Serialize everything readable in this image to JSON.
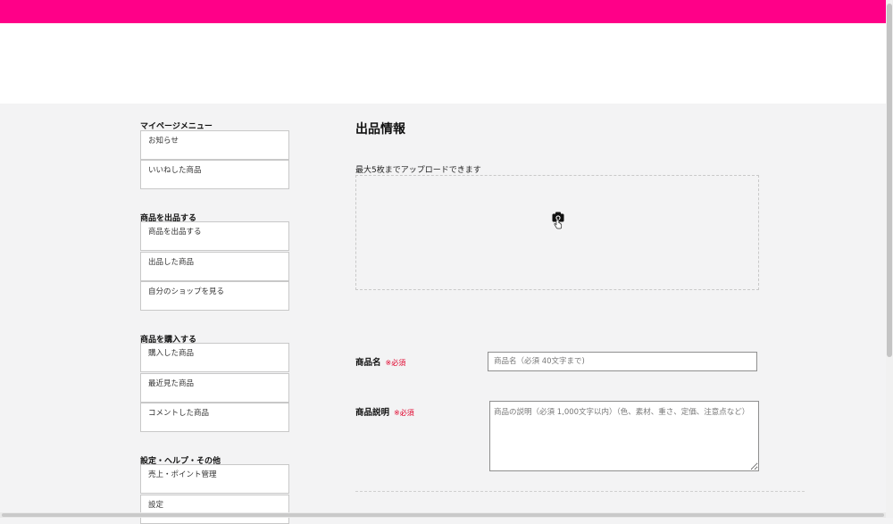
{
  "sidebar": {
    "sections": [
      {
        "title": "マイページメニュー",
        "items": [
          "お知らせ",
          "いいねした商品"
        ]
      },
      {
        "title": "商品を出品する",
        "items": [
          "商品を出品する",
          "出品した商品",
          "自分のショップを見る"
        ]
      },
      {
        "title": "商品を購入する",
        "items": [
          "購入した商品",
          "最近見た商品",
          "コメントした商品"
        ]
      },
      {
        "title": "設定・ヘルプ・その他",
        "items": [
          "売上・ポイント管理",
          "設定"
        ]
      }
    ]
  },
  "main": {
    "title": "出品情報",
    "upload_note": "最大5枚までアップロードできます",
    "dropzone_icon": "camera-icon",
    "name_field": {
      "label": "商品名",
      "required": "※必須",
      "placeholder": "商品名（必須 40文字まで)"
    },
    "desc_field": {
      "label": "商品説明",
      "required": "※必須",
      "placeholder": "商品の説明（必須 1,000文字以内）（色、素材、重さ、定価、注意点など）"
    }
  },
  "colors": {
    "brand": "#ff0088",
    "required": "#e0002a"
  }
}
